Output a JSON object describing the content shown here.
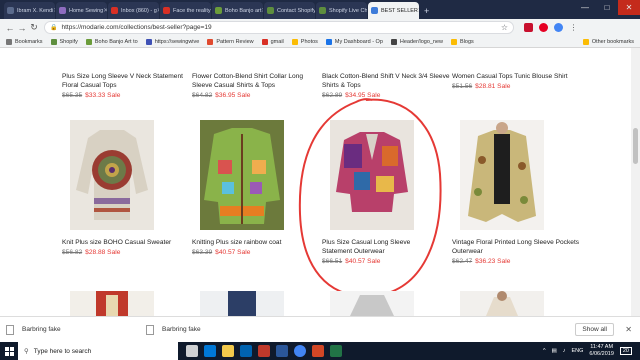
{
  "tabs": [
    {
      "label": "Ibram X. Kendi",
      "color": "#5b6b8c"
    },
    {
      "label": "Home Sewing",
      "color": "#8e6cbf"
    },
    {
      "label": "Inbox (860) - g",
      "color": "#d93025"
    },
    {
      "label": "Face the reality",
      "color": "#d93025"
    },
    {
      "label": "Boho Banjo art",
      "color": "#6b9c3a"
    },
    {
      "label": "Contact Shopify",
      "color": "#5e8e3e"
    },
    {
      "label": "Shopify Live Ch",
      "color": "#5e8e3e"
    },
    {
      "label": "BEST SELLER",
      "color": "#3d7bd9",
      "active": true
    }
  ],
  "toolbar": {
    "url": "https://modarie.com/collections/best-seller?page=19"
  },
  "bookmarks": [
    {
      "label": "Bookmarks",
      "color": "#777"
    },
    {
      "label": "Shopify",
      "color": "#5e8e3e"
    },
    {
      "label": "Boho Banjo Art to",
      "color": "#6b9c3a"
    },
    {
      "label": "https://sewingwive",
      "color": "#3f51b5"
    },
    {
      "label": "Pattern Review",
      "color": "#e04a2f"
    },
    {
      "label": "gmail",
      "color": "#d93025"
    },
    {
      "label": "Photos",
      "color": "#fbbc04"
    },
    {
      "label": "My Dashboard - Op",
      "color": "#1a73e8"
    },
    {
      "label": "Header/logo_new",
      "color": "#444"
    },
    {
      "label": "Blogs",
      "color": "#fbbc04"
    }
  ],
  "bookmarks_other": "Other bookmarks",
  "row1": [
    {
      "title": "Plus Size Long Sleeve V Neck Statement Floral Casual Tops",
      "old": "$65.35",
      "new": "$33.33 Sale"
    },
    {
      "title": "Flower Cotton-Blend Shirt Collar Long Sleeve Casual Shirts & Tops",
      "old": "$64.82",
      "new": "$36.95 Sale"
    },
    {
      "title": "Black Cotton-Blend Shift V Neck 3/4 Sleeve Shirts & Tops",
      "old": "$62.89",
      "new": "$34.95 Sale"
    },
    {
      "title": "Women Casual Tops Tunic Blouse Shirt",
      "old": "$51.56",
      "new": "$28.81 Sale"
    }
  ],
  "row2": [
    {
      "title": "Knit Plus size BOHO Casual Sweater",
      "old": "$56.82",
      "new": "$28.88 Sale"
    },
    {
      "title": "Knitting Plus size rainbow coat",
      "old": "$63.39",
      "new": "$40.57 Sale"
    },
    {
      "title": "Plus Size Casual Long Sleeve Statement Outerwear",
      "old": "$66.51",
      "new": "$40.57 Sale"
    },
    {
      "title": "Vintage Floral Printed Long Sleeve Pockets Outerwear",
      "old": "$62.47",
      "new": "$36.23 Sale"
    }
  ],
  "downloads": {
    "items": [
      "Barbring fake",
      "Barbring fake"
    ],
    "show_all": "Show all"
  },
  "taskbar": {
    "search_placeholder": "Type here to search",
    "lang": "ENG",
    "time": "11:47 AM",
    "date": "6/06/2019",
    "notifications": "20"
  },
  "accent": "#e53935"
}
